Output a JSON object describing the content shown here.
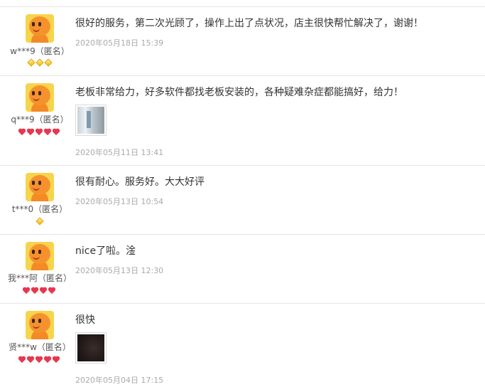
{
  "reviews": [
    {
      "username": "w***9（匿名）",
      "badge_type": "diamond",
      "badge_count": 3,
      "comment": "很好的服务，第二次光顾了，操作上出了点状况，店主很快帮忙解决了，谢谢！",
      "date": "2020年05月18日 15:39",
      "has_image": false
    },
    {
      "username": "q***9（匿名）",
      "badge_type": "heart",
      "badge_count": 5,
      "comment": "老板非常给力，好多软件都找老板安装的，各种疑难杂症都能搞好，给力！",
      "date": "2020年05月11日 13:41",
      "has_image": true
    },
    {
      "username": "t***0（匿名）",
      "badge_type": "diamond",
      "badge_count": 1,
      "comment": "很有耐心。服务好。大大好评",
      "date": "2020年05月13日 10:54",
      "has_image": false
    },
    {
      "username": "我***阿（匿名）",
      "badge_type": "heart",
      "badge_count": 4,
      "comment": "nice了啦。淦",
      "date": "2020年05月13日 12:30",
      "has_image": false
    },
    {
      "username": "贤***w（匿名）",
      "badge_type": "heart",
      "badge_count": 5,
      "comment": "很快",
      "date": "2020年05月04日 17:15",
      "has_image": true
    }
  ],
  "colors": {
    "separator": "#e6e6e6",
    "date": "#aaaaaa",
    "heart_badge": "#e8364e",
    "diamond_badge": "#f5b500"
  }
}
